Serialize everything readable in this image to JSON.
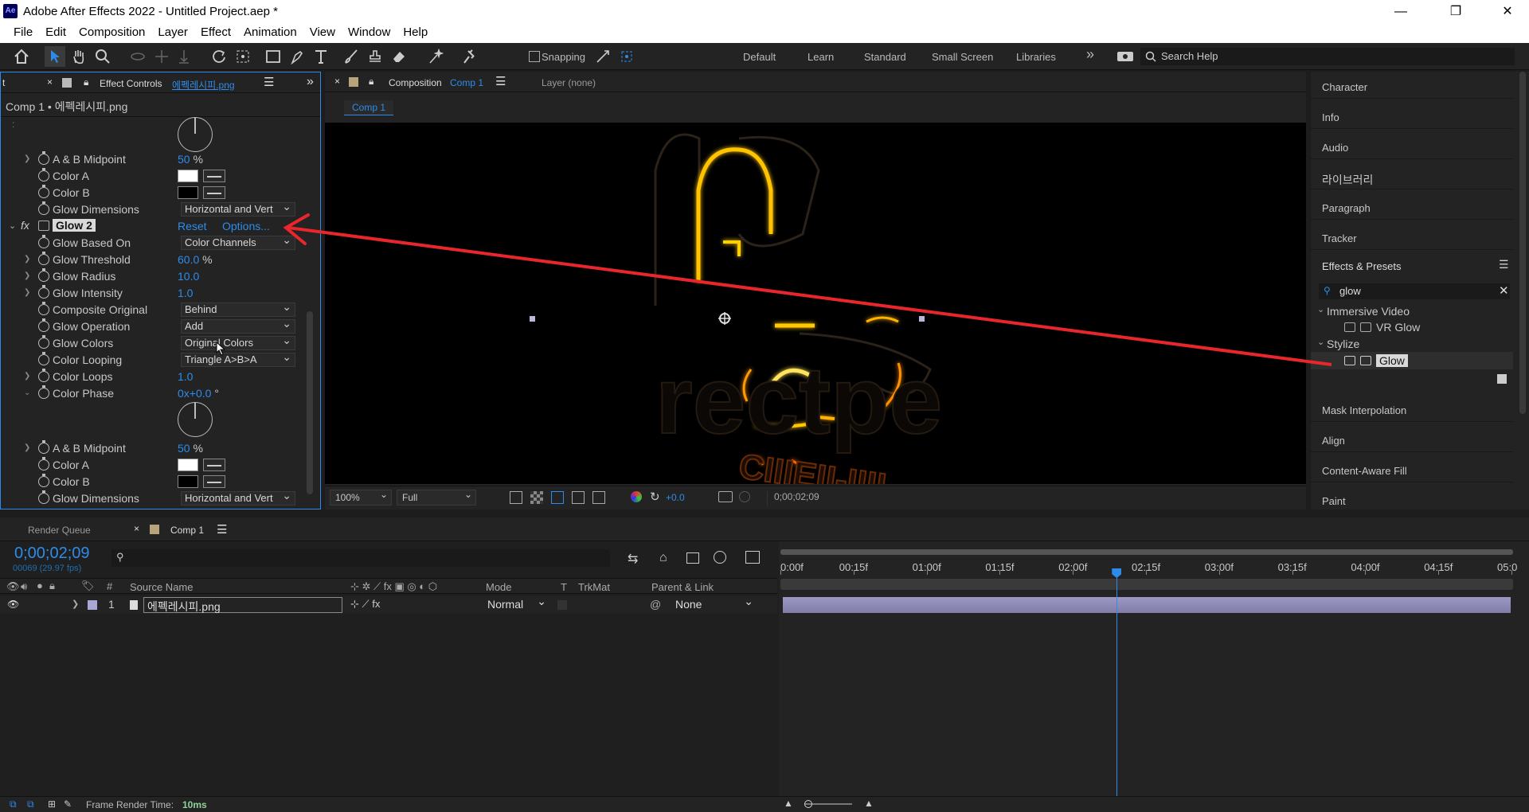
{
  "window": {
    "title": "Adobe After Effects 2022 - Untitled Project.aep *",
    "logo": "Ae",
    "controls": [
      "—",
      "❐",
      "✕"
    ]
  },
  "menu": [
    "File",
    "Edit",
    "Composition",
    "Layer",
    "Effect",
    "Animation",
    "View",
    "Window",
    "Help"
  ],
  "toolbar": {
    "snapping_label": "Snapping",
    "workspaces": [
      "Default",
      "Learn",
      "Standard",
      "Small Screen",
      "Libraries"
    ],
    "more": "»",
    "search_placeholder": "Search Help"
  },
  "effect_controls": {
    "tab_label": "Effect Controls",
    "tab_file": "에펙레시피.png",
    "left_tab": "t",
    "header": "Comp 1 • 에펙레시피.png",
    "rows_top": [
      {
        "label": "A & B Midpoint",
        "value": "50",
        "unit": "%"
      },
      {
        "label": "Color A"
      },
      {
        "label": "Color B"
      },
      {
        "label": "Glow Dimensions",
        "dropdown": "Horizontal and Vert"
      }
    ],
    "effect": {
      "fx": "fx",
      "name": "Glow 2",
      "reset": "Reset",
      "options": "Options..."
    },
    "rows": [
      {
        "label": "Glow Based On",
        "dropdown": "Color Channels"
      },
      {
        "label": "Glow Threshold",
        "value": "60.0",
        "unit": "%"
      },
      {
        "label": "Glow Radius",
        "value": "10.0"
      },
      {
        "label": "Glow Intensity",
        "value": "1.0"
      },
      {
        "label": "Composite Original",
        "dropdown": "Behind"
      },
      {
        "label": "Glow Operation",
        "dropdown": "Add"
      },
      {
        "label": "Glow Colors",
        "dropdown": "Original Colors"
      },
      {
        "label": "Color Looping",
        "dropdown": "Triangle A>B>A"
      },
      {
        "label": "Color Loops",
        "value": "1.0"
      },
      {
        "label": "Color Phase",
        "value": "0x+0.0",
        "unit": "°"
      }
    ],
    "rows_bottom": [
      {
        "label": "A & B Midpoint",
        "value": "50",
        "unit": "%"
      },
      {
        "label": "Color A"
      },
      {
        "label": "Color B"
      },
      {
        "label": "Glow Dimensions",
        "dropdown": "Horizontal and Vert"
      }
    ]
  },
  "composition": {
    "tab_label": "Composition",
    "tab_comp": "Comp 1",
    "layer_tab": "Layer (none)",
    "sub_tab": "Comp 1",
    "zoom": "100%",
    "resolution": "Full",
    "exposure": "+0.0",
    "timecode": "0;00;02;09"
  },
  "right_panels": {
    "top": [
      "Character",
      "Info",
      "Audio",
      "라이브러리",
      "Paragraph",
      "Tracker"
    ],
    "effects_presets": {
      "title": "Effects & Presets",
      "search_value": "glow",
      "groups": [
        {
          "name": "Immersive Video",
          "items": [
            "VR Glow"
          ]
        },
        {
          "name": "Stylize",
          "items": [
            "Glow"
          ]
        }
      ]
    },
    "bottom": [
      "Mask Interpolation",
      "Align",
      "Content-Aware Fill",
      "Paint"
    ]
  },
  "timeline": {
    "render_queue": "Render Queue",
    "comp_tab": "Comp 1",
    "timecode": "0;00;02;09",
    "frame_info": "00069 (29.97 fps)",
    "columns": {
      "source_name": "Source Name",
      "mode": "Mode",
      "t": "T",
      "trkmat": "TrkMat",
      "parent": "Parent & Link"
    },
    "layer": {
      "index": "1",
      "name": "에펙레시피.png",
      "mode": "Normal",
      "parent": "None"
    },
    "ruler": [
      "0:00f",
      "00:15f",
      "01:00f",
      "01:15f",
      "02:00f",
      "02:15f",
      "03:00f",
      "03:15f",
      "04:00f",
      "04:15f",
      "05:0"
    ],
    "playhead_seconds": 2.3,
    "duration_seconds": 5
  },
  "status": {
    "label": "Frame Render Time:",
    "value": "10ms"
  },
  "colors": {
    "accent_blue": "#2d8ceb",
    "arrow_red": "#e8262c",
    "layer_bar": "#8c8ab0",
    "glow": "#ffb400"
  }
}
